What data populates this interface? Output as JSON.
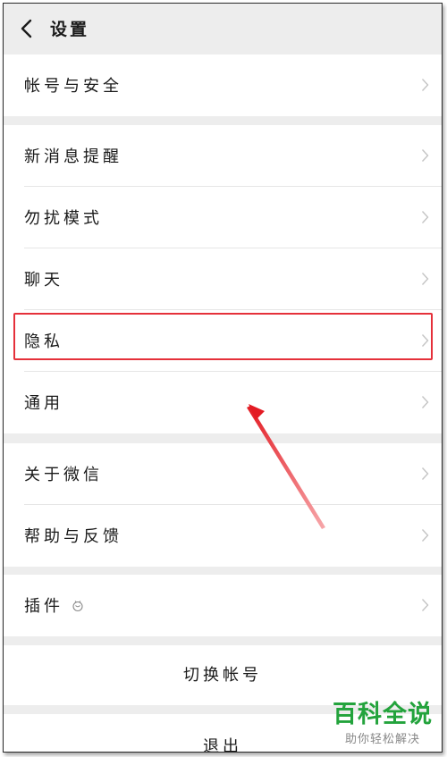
{
  "header": {
    "title": "设置"
  },
  "rows": {
    "account_security": "帐号与安全",
    "new_message_alert": "新消息提醒",
    "do_not_disturb": "勿扰模式",
    "chat": "聊天",
    "privacy": "隐私",
    "general": "通用",
    "about_wechat": "关于微信",
    "help_feedback": "帮助与反馈",
    "plugins": "插件"
  },
  "actions": {
    "switch_account": "切换帐号",
    "logout": "退出"
  },
  "watermark": {
    "brand": "百科全说",
    "slogan": "助你轻松解决"
  },
  "colors": {
    "background": "#ededed",
    "highlight": "#e5303a",
    "watermark": "#23a33c"
  },
  "icons": {
    "back": "chevron-left-icon",
    "row_arrow": "chevron-right-icon",
    "plugin": "plugin-icon"
  }
}
